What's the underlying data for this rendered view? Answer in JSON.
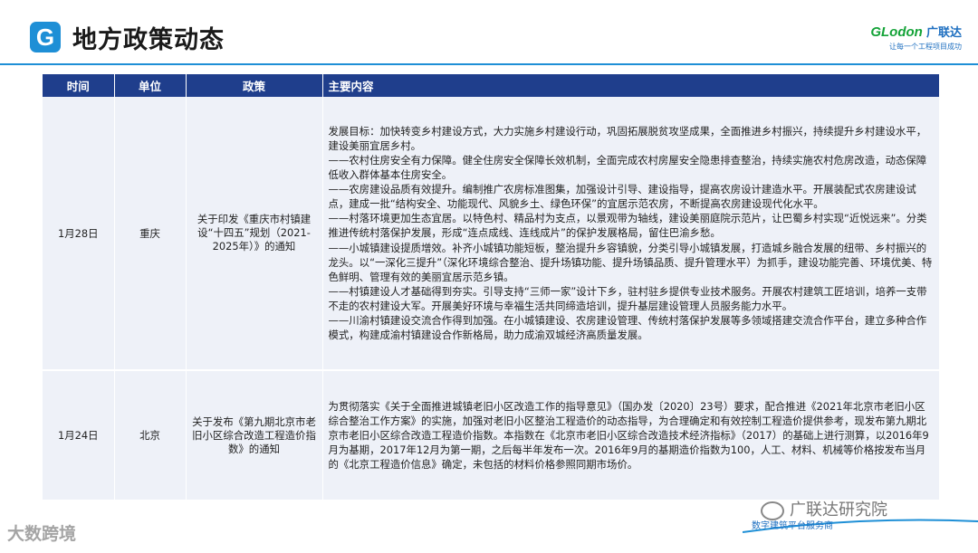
{
  "header": {
    "logo_letter": "G",
    "title": "地方政策动态",
    "brand_latin": "GLodon",
    "brand_cn": "广联达",
    "brand_slogan": "让每一个工程项目成功"
  },
  "table": {
    "headers": [
      "时间",
      "单位",
      "政策",
      "主要内容"
    ],
    "rows": [
      {
        "time": "1月28日",
        "unit": "重庆",
        "policy": "关于印发《重庆市村镇建设“十四五”规划（2021-2025年）》的通知",
        "content": "发展目标：加快转变乡村建设方式，大力实施乡村建设行动，巩固拓展脱贫攻坚成果，全面推进乡村振兴，持续提升乡村建设水平，建设美丽宜居乡村。\n——农村住房安全有力保障。健全住房安全保障长效机制，全面完成农村房屋安全隐患排查整治，持续实施农村危房改造，动态保障低收入群体基本住房安全。\n——农房建设品质有效提升。编制推广农房标准图集，加强设计引导、建设指导，提高农房设计建造水平。开展装配式农房建设试点，建成一批“结构安全、功能现代、风貌乡土、绿色环保”的宜居示范农房，不断提高农房建设现代化水平。\n——村落环境更加生态宜居。以特色村、精品村为支点，以景观带为轴线，建设美丽庭院示范片，让巴蜀乡村实现“近悦远来”。分类推进传统村落保护发展，形成“连点成线、连线成片”的保护发展格局，留住巴渝乡愁。\n——小城镇建设提质增效。补齐小城镇功能短板，整治提升乡容镇貌，分类引导小城镇发展，打造城乡融合发展的纽带、乡村振兴的龙头。以“一深化三提升”（深化环境综合整治、提升场镇功能、提升场镇品质、提升管理水平）为抓手，建设功能完善、环境优美、特色鲜明、管理有效的美丽宜居示范乡镇。\n——村镇建设人才基础得到夯实。引导支持“三师一家”设计下乡，驻村驻乡提供专业技术服务。开展农村建筑工匠培训，培养一支带不走的农村建设大军。开展美好环境与幸福生活共同缔造培训，提升基层建设管理人员服务能力水平。\n——川渝村镇建设交流合作得到加强。在小城镇建设、农房建设管理、传统村落保护发展等多领域搭建交流合作平台，建立多种合作模式，构建成渝村镇建设合作新格局，助力成渝双城经济高质量发展。"
      },
      {
        "time": "1月24日",
        "unit": "北京",
        "policy": "关于发布《第九期北京市老旧小区综合改造工程造价指数》的通知",
        "content": "为贯彻落实《关于全面推进城镇老旧小区改造工作的指导意见》（国办发〔2020〕23号）要求，配合推进《2021年北京市老旧小区综合整治工作方案》的实施，加强对老旧小区整治工程造价的动态指导，为合理确定和有效控制工程造价提供参考，现发布第九期北京市老旧小区综合改造工程造价指数。本指数在《北京市老旧小区综合改造技术经济指标》（2017）的基础上进行测算，以2016年9月为基期，2017年12月为第一期，之后每半年发布一次。2016年9月的基期造价指数为100，人工、材料、机械等价格按发布当月的《北京工程造价信息》确定，未包括的材料价格参照同期市场价。"
      }
    ]
  },
  "watermark": {
    "text": "大数跨境"
  },
  "footer": {
    "wechat_account": "广联达研究院",
    "tagline": "数字建筑平台服务商"
  }
}
